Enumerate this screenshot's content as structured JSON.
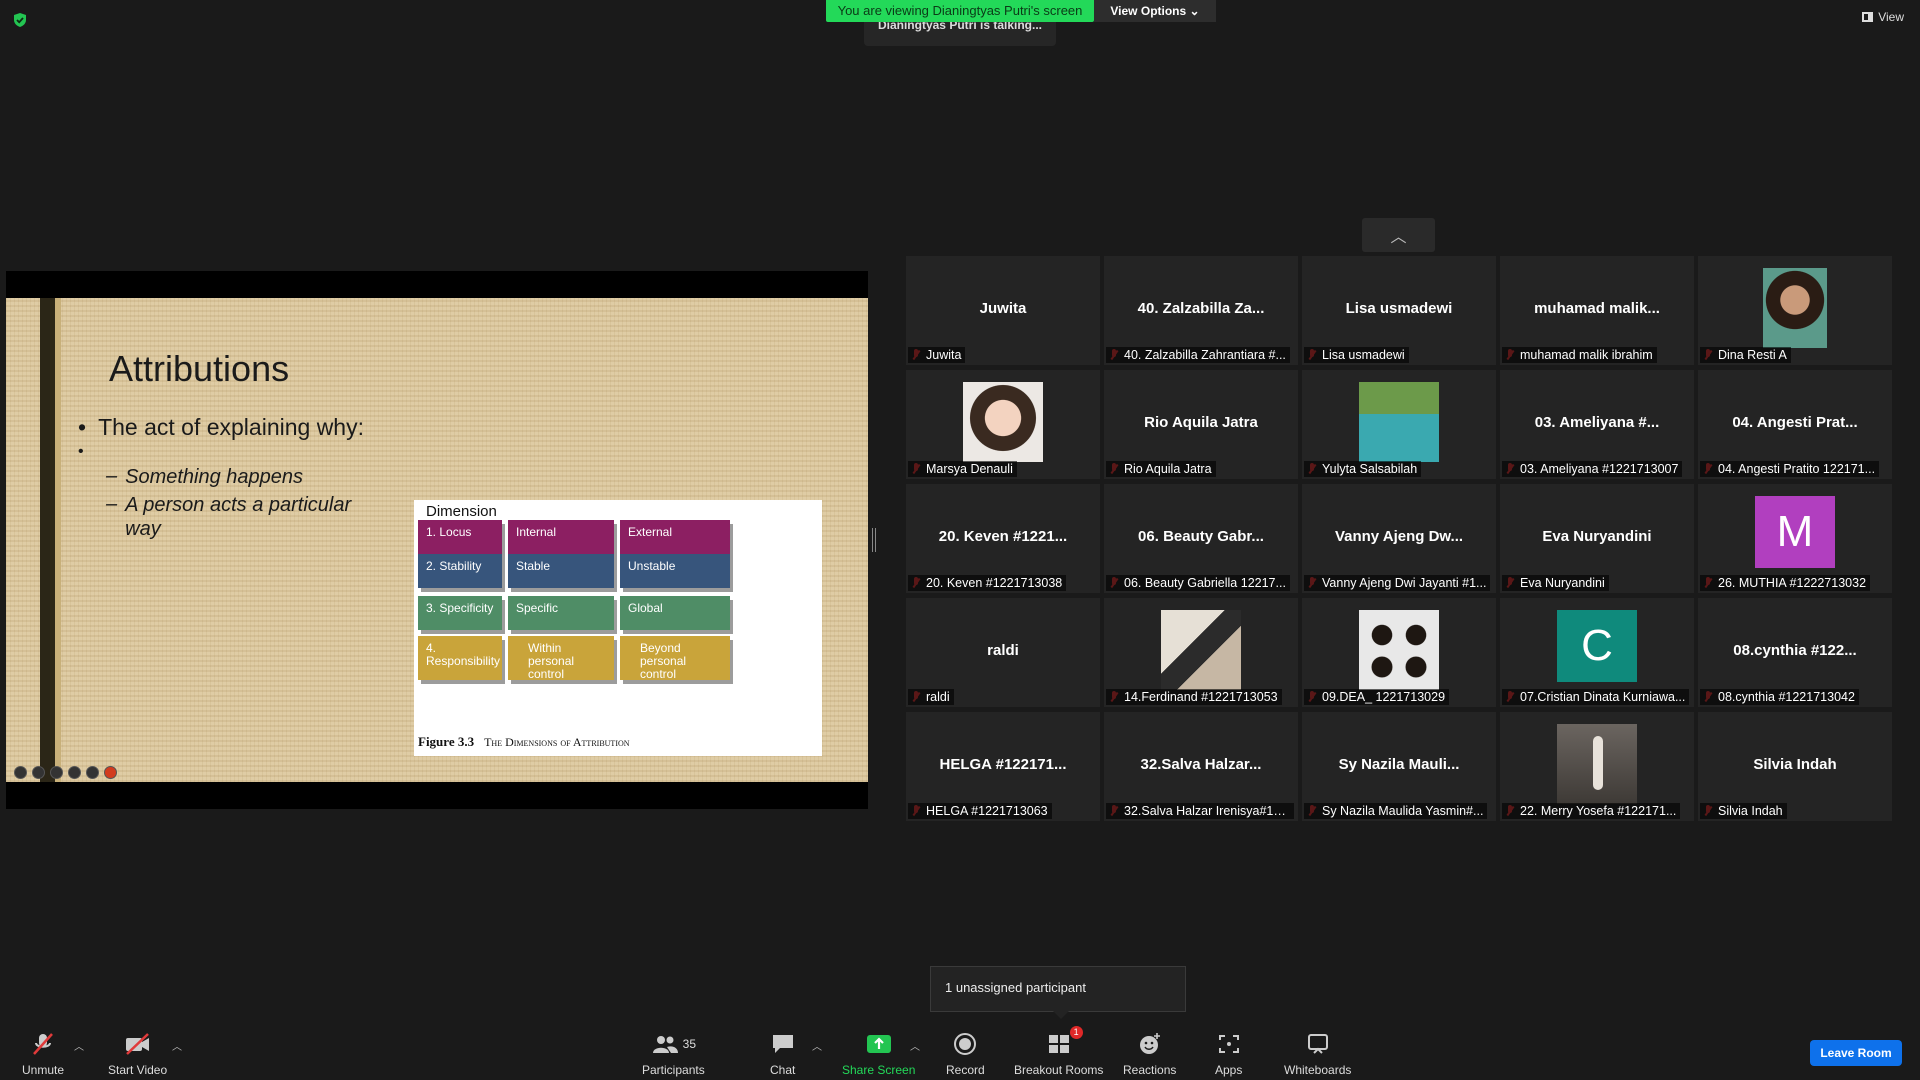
{
  "top": {
    "viewing_banner": "You are viewing Dianingtyas Putri's screen",
    "view_options": "View Options",
    "talking": "Dianingtyas Putri is talking...",
    "view_label": "View"
  },
  "slide": {
    "title": "Attributions",
    "bullet1": "The act of explaining why:",
    "bullet2": "",
    "sub1": "Something happens",
    "sub2": "A person acts a particular way",
    "figure": {
      "dimension_label": "Dimension",
      "rows": [
        {
          "c1": "1. Locus",
          "c2": "Internal",
          "c3": "External",
          "color": "#8c1f62"
        },
        {
          "c1": "2. Stability",
          "c2": "Stable",
          "c3": "Unstable",
          "color": "#37557c"
        },
        {
          "c1": "3. Specificity",
          "c2": "Specific",
          "c3": "Global",
          "color": "#4f8d66"
        },
        {
          "c1": "4. Responsibility",
          "c2": "Within personal control",
          "c3": "Beyond personal control",
          "color": "#c9a43a"
        }
      ],
      "caption_num": "Figure 3.3",
      "caption_text": "The Dimensions of Attribution"
    }
  },
  "gallery": {
    "tiles": [
      {
        "name": "Juwita",
        "label": "Juwita"
      },
      {
        "name": "40. Zalzabilla Za...",
        "label": "40. Zalzabilla Zahrantiara #..."
      },
      {
        "name": "Lisa usmadewi",
        "label": "Lisa usmadewi"
      },
      {
        "name": "muhamad  malik...",
        "label": "muhamad malik ibrahim"
      },
      {
        "name": "",
        "label": "Dina Resti A",
        "photo": "face2"
      },
      {
        "name": "",
        "label": "Marsya Denauli",
        "photo": "face"
      },
      {
        "name": "Rio Aquila Jatra",
        "label": "Rio Aquila Jatra"
      },
      {
        "name": "",
        "label": "Yulyta Salsabilah",
        "photo": "lake"
      },
      {
        "name": "03. Ameliyana #...",
        "label": "03. Ameliyana #1221713007"
      },
      {
        "name": "04. Angesti Prat...",
        "label": "04. Angesti Pratito 122171..."
      },
      {
        "name": "20. Keven #1221...",
        "label": "20. Keven #1221713038"
      },
      {
        "name": "06. Beauty Gabr...",
        "label": "06. Beauty Gabriella 12217..."
      },
      {
        "name": "Vanny Ajeng Dw...",
        "label": "Vanny Ajeng Dwi Jayanti #1..."
      },
      {
        "name": "Eva Nuryandini",
        "label": "Eva Nuryandini"
      },
      {
        "name": "",
        "label": "26. MUTHIA #1222713032",
        "avatar": "M",
        "avatar_color": "#b13fbf"
      },
      {
        "name": "raldi",
        "label": "raldi"
      },
      {
        "name": "",
        "label": "14.Ferdinand #1221713053",
        "photo": "man"
      },
      {
        "name": "",
        "label": "09.DEA_ 1221713029",
        "photo": "group"
      },
      {
        "name": "",
        "label": "07.Cristian Dinata Kurniawa...",
        "avatar": "C",
        "avatar_color": "#0f8a7c"
      },
      {
        "name": "08.cynthia #122...",
        "label": "08.cynthia #1221713042"
      },
      {
        "name": "HELGA #122171...",
        "label": "HELGA #1221713063"
      },
      {
        "name": "32.Salva  Halzar...",
        "label": "32.Salva Halzar Irenisya#12..."
      },
      {
        "name": "Sy  Nazila Mauli...",
        "label": "Sy Nazila Maulida Yasmin#..."
      },
      {
        "name": "",
        "label": "22. Merry Yosefa #122171...",
        "photo": "rock"
      },
      {
        "name": "Silvia Indah",
        "label": "Silvia Indah"
      }
    ]
  },
  "toast": "1 unassigned participant",
  "toolbar": {
    "unmute": "Unmute",
    "start_video": "Start Video",
    "participants": "Participants",
    "participants_count": "35",
    "chat": "Chat",
    "share_screen": "Share Screen",
    "record": "Record",
    "breakout_rooms": "Breakout Rooms",
    "breakout_badge": "1",
    "reactions": "Reactions",
    "apps": "Apps",
    "whiteboards": "Whiteboards",
    "leave_room": "Leave Room"
  },
  "colors": {
    "share_green": "#23d959",
    "leave_blue": "#0e71eb",
    "muted_red": "#e03a3a"
  }
}
